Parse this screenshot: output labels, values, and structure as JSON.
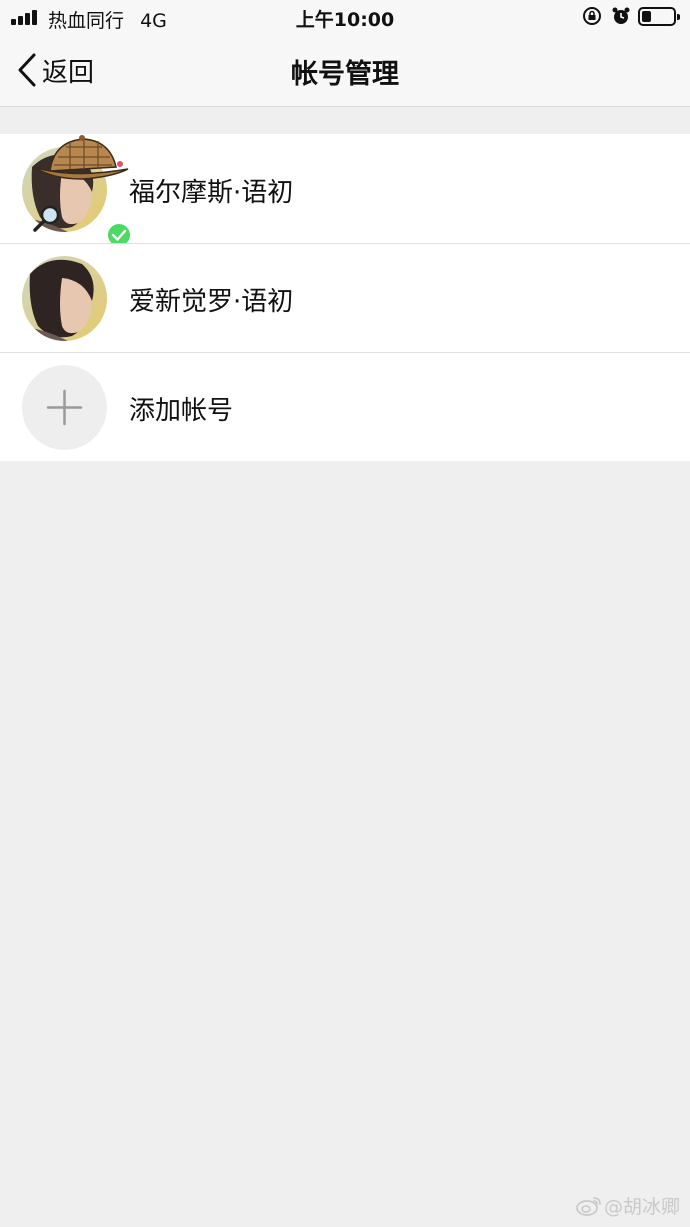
{
  "status_bar": {
    "carrier": "热血同行",
    "network": "4G",
    "time": "上午10:00",
    "battery_level": 0.3
  },
  "nav": {
    "back_label": "返回",
    "title": "帐号管理"
  },
  "accounts": [
    {
      "name": "福尔摩斯·语初",
      "active": true
    },
    {
      "name": "爱新觉罗·语初",
      "active": false
    }
  ],
  "add_account_label": "添加帐号",
  "watermark": "@胡冰卿",
  "icons": {
    "back": "chevron-left-icon",
    "add": "plus-icon",
    "check": "check-badge-icon",
    "lock": "rotation-lock-icon",
    "alarm": "alarm-icon",
    "battery": "battery-icon",
    "signal": "signal-icon"
  },
  "colors": {
    "check_badge": "#4cd964",
    "background": "#efefef"
  }
}
